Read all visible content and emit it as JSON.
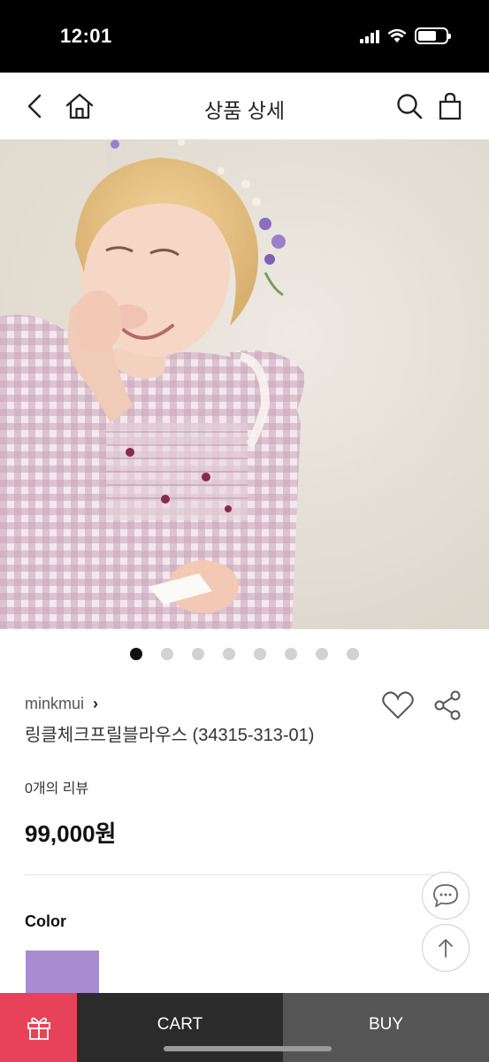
{
  "status_bar": {
    "time": "12:01"
  },
  "header": {
    "title": "상품 상세",
    "icons": [
      "back-chevron-icon",
      "home-icon",
      "search-icon",
      "shopping-bag-icon"
    ]
  },
  "gallery": {
    "image_description_icon": "product-photo",
    "total_slides": 8,
    "active_slide": 1
  },
  "product": {
    "brand": "minkmui",
    "brand_chevron": "›",
    "name": "링클체크프릴블라우스 (34315-313-01)",
    "reviews": "0개의 리뷰",
    "price": "99,000원"
  },
  "options": {
    "color_label": "Color",
    "swatch_color": "#a98bd0"
  },
  "bottom_bar": {
    "gift_icon": "gift-icon",
    "cart_label": "CART",
    "buy_label": "BUY"
  },
  "colors": {
    "gift_bg": "#e8425a",
    "cart_bg": "#2b2b2b",
    "buy_bg": "#555555"
  }
}
